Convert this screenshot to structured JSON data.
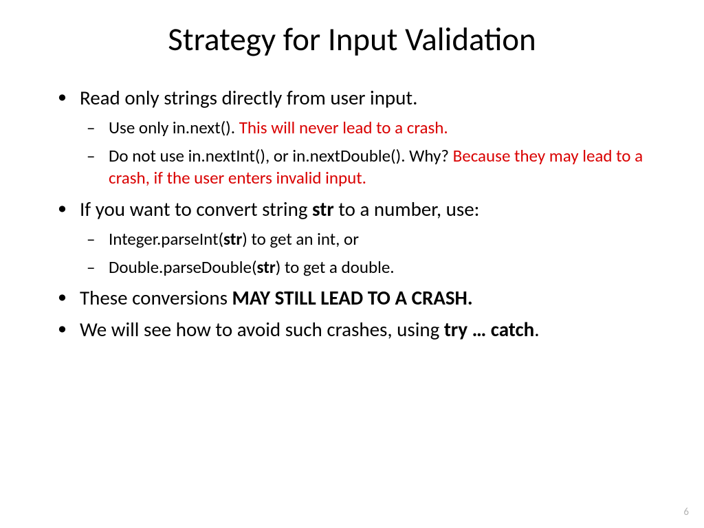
{
  "title": "Strategy for Input Validation",
  "b1": {
    "t": "Read only strings directly from user input.",
    "s1a": "Use only in.next(). ",
    "s1b": "This will never lead to a crash.",
    "s2a": "Do not use in.nextInt(), or in.nextDouble(). Why? ",
    "s2b": "Because they may lead to a crash, if the user enters invalid input."
  },
  "b2": {
    "t1": "If you want to convert string ",
    "t2": "str",
    "t3": " to a number, use:",
    "s1a": "Integer.parseInt(",
    "s1b": "str",
    "s1c": ") to get an int, or",
    "s2a": "Double.parseDouble(",
    "s2b": "str",
    "s2c": ") to get a double."
  },
  "b3": {
    "t1": "These conversions ",
    "t2": "MAY STILL LEAD TO A CRASH."
  },
  "b4": {
    "t1": "We will see how to avoid such crashes, using ",
    "t2": "try … catch",
    "t3": "."
  },
  "pagenum": "6"
}
